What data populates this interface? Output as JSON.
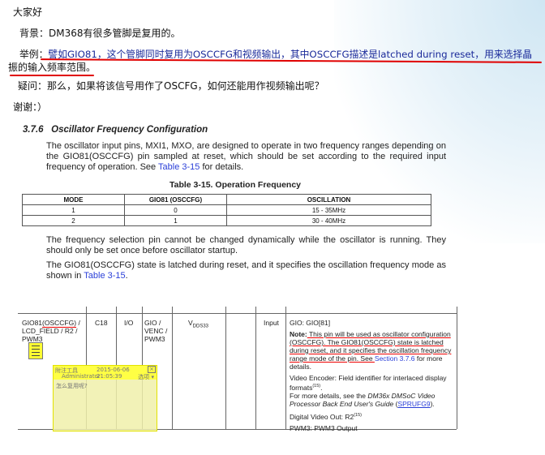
{
  "post": {
    "greeting": "大家好",
    "background_label": "背景：",
    "background_text": "DM368有很多管脚是复用的。",
    "example_label": "举例：",
    "example_line1": "譬如GIO81，这个管脚同时复用为OSCCFG和视频输出，其中OSCCFG描述是latched during reset，用来选择晶",
    "example_line2": "振的输入频率范围。",
    "question_label": "疑问：",
    "question_text": "那么，如果将该信号用作了OSCFG，如何还能用作视频输出呢？",
    "thanks": "谢谢：）"
  },
  "section": {
    "number": "3.7.6",
    "title": "Oscillator Frequency Configuration",
    "p1": "The oscillator input pins, MXI1, MXO, are designed to operate in two frequency ranges depending on the GIO81(OSCCFG) pin sampled at reset, which should be set according to the required input frequency of operation. See ",
    "p1_link": "Table 3-15",
    "p1_end": " for details.",
    "table_title": "Table 3-15. Operation Frequency",
    "table": {
      "headers": [
        "MODE",
        "GIO81 (OSCCFG)",
        "OSCILLATION"
      ],
      "rows": [
        [
          "1",
          "0",
          "15 - 35MHz"
        ],
        [
          "2",
          "1",
          "30 - 40MHz"
        ]
      ]
    },
    "p2": "The frequency selection pin cannot be changed dynamically while the oscillator is running. They should only be set once before oscillator startup.",
    "p3": "The GIO81(OSCCFG) state is latched during reset, and it specifies the oscillation frequency mode as shown in ",
    "p3_link": "Table 3-15",
    "p3_end": "."
  },
  "pin_table": {
    "name_a": "GIO81",
    "name_b": "(OSCCFG)",
    "name_c": " / LCD_FIELD / R2 / PWM3",
    "ball": "C18",
    "type": "I/O",
    "mux": "GIO / VENC / PWM3",
    "supply": "V",
    "supply_sub": "DDS33",
    "direction": "Input",
    "desc_gio": "GIO: GIO[81]",
    "note_label": "Note:",
    "note_text": " This pin will be used as oscillator configuration (OSCCFG). The GIO81(OSCCFG) state is latched during reset, and it specifies the oscillation frequency range mode of the pin. See ",
    "note_link": "Section 3.7.6",
    "note_end": " for more details.",
    "venc": "Video Encoder: Field identifier for interlaced display formats",
    "venc_sup": "(15)",
    "more": "For more details, see the ",
    "more_italic": "DM36x DMSoC Video Processor Back End User's Guide",
    "more_link": "SPRUFG9",
    "more_end": ").",
    "dvo": "Digital Video Out: R2",
    "dvo_sup": "(15)",
    "pwm": "PWM3: PWM3 Output"
  },
  "annotation": {
    "tool": "附注工具",
    "timestamp": "2015-06-06 21:05:39",
    "author": "Administrator",
    "options": "选项 ▾",
    "close": "×",
    "text": "怎么复用呢?"
  }
}
